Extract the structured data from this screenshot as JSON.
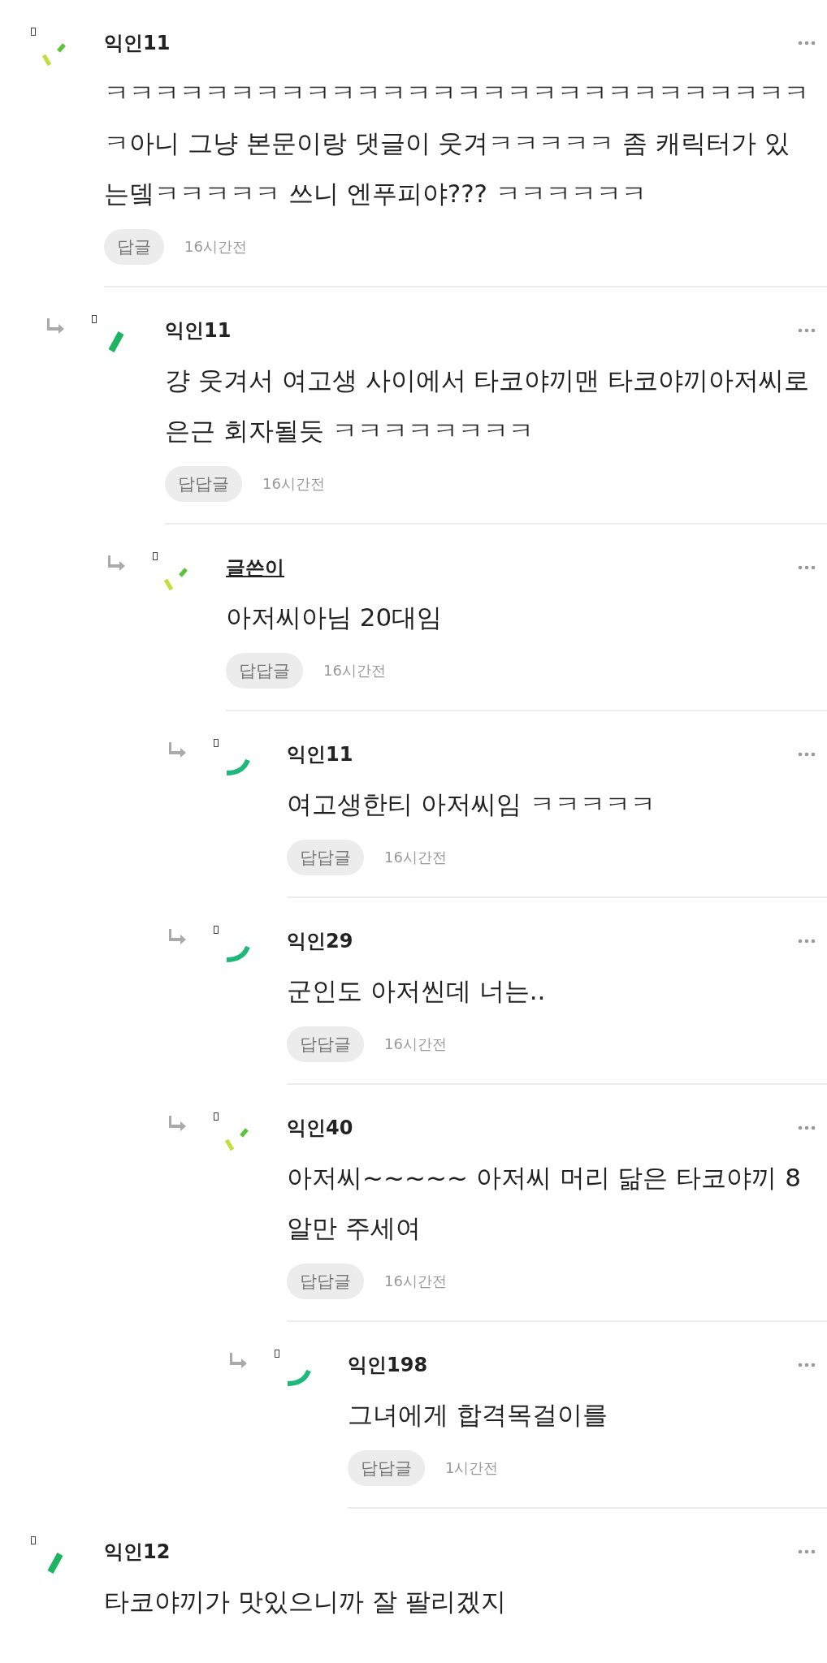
{
  "comments": [
    {
      "author": "익인11",
      "is_author": false,
      "kind": "dashes",
      "text": "ㅋㅋㅋㅋㅋㅋㅋㅋㅋㅋㅋㅋㅋㅋㅋㅋㅋㅋㅋㅋㅋㅋㅋㅋㅋㅋㅋㅋㅋ아니 그냥 본문이랑 댓글이 웃겨ㅋㅋㅋㅋㅋ 좀 캐릭터가 있는뎈ㅋㅋㅋㅋㅋ 쓰니 엔푸피야??? ㅋㅋㅋㅋㅋㅋ",
      "reply_label": "답글",
      "time": "16시간전",
      "children": [
        {
          "author": "익인11",
          "is_author": false,
          "kind": "bar",
          "text": "걍 웃겨서 여고생 사이에서 타코야끼맨 타코야끼아저씨로 은근 회자될듯 ㅋㅋㅋㅋㅋㅋㅋㅋ",
          "reply_label": "답답글",
          "time": "16시간전",
          "children": [
            {
              "author": "글쓴이",
              "is_author": true,
              "kind": "dashes",
              "text": "아저씨아님 20대임",
              "reply_label": "답답글",
              "time": "16시간전",
              "children": [
                {
                  "author": "익인11",
                  "is_author": false,
                  "kind": "arc",
                  "text": "여고생한티 아저씨임 ㅋㅋㅋㅋㅋ",
                  "reply_label": "답답글",
                  "time": "16시간전"
                },
                {
                  "author": "익인29",
                  "is_author": false,
                  "kind": "arc",
                  "text": "군인도 아저씬데 너는..",
                  "reply_label": "답답글",
                  "time": "16시간전"
                },
                {
                  "author": "익인40",
                  "is_author": false,
                  "kind": "dashes",
                  "text": "아저씨~~~~~ 아저씨 머리 닮은 타코야끼 8알만 주세여",
                  "reply_label": "답답글",
                  "time": "16시간전",
                  "children": [
                    {
                      "author": "익인198",
                      "is_author": false,
                      "kind": "arc",
                      "text": "그녀에게 합격목걸이를",
                      "reply_label": "답답글",
                      "time": "1시간전"
                    }
                  ]
                }
              ]
            }
          ]
        }
      ]
    },
    {
      "author": "익인12",
      "is_author": false,
      "kind": "bar",
      "text": "타코야끼가 맛있으니까 잘 팔리겠지"
    }
  ]
}
